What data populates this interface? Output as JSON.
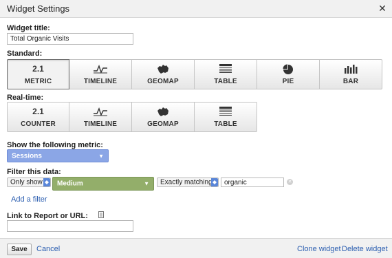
{
  "dialog": {
    "title": "Widget Settings",
    "close_glyph": "✕"
  },
  "widget_title": {
    "label": "Widget title:",
    "value": "Total Organic Visits"
  },
  "standard": {
    "label": "Standard:",
    "items": [
      {
        "icon_text": "2.1",
        "label": "METRIC",
        "icon": "metric-icon",
        "selected": true
      },
      {
        "icon_text": "",
        "label": "TIMELINE",
        "icon": "timeline-icon"
      },
      {
        "icon_text": "",
        "label": "GEOMAP",
        "icon": "geomap-icon"
      },
      {
        "icon_text": "",
        "label": "TABLE",
        "icon": "table-icon"
      },
      {
        "icon_text": "",
        "label": "PIE",
        "icon": "pie-icon"
      },
      {
        "icon_text": "",
        "label": "BAR",
        "icon": "bar-chart-icon"
      }
    ]
  },
  "realtime": {
    "label": "Real-time:",
    "items": [
      {
        "icon_text": "2.1",
        "label": "COUNTER",
        "icon": "counter-icon"
      },
      {
        "icon_text": "",
        "label": "TIMELINE",
        "icon": "timeline-icon"
      },
      {
        "icon_text": "",
        "label": "GEOMAP",
        "icon": "geomap-icon"
      },
      {
        "icon_text": "",
        "label": "TABLE",
        "icon": "table-icon"
      }
    ]
  },
  "metric": {
    "label": "Show the following metric:",
    "selected": "Sessions",
    "color": "#8ba6e6"
  },
  "filter": {
    "label": "Filter this data:",
    "mode": "Only show",
    "dimension": "Medium",
    "dimension_color": "#93ae6a",
    "match_type": "Exactly matching",
    "value": "organic",
    "add_filter_label": "Add a filter"
  },
  "link": {
    "label": "Link to Report or URL:",
    "value": ""
  },
  "footer": {
    "save_label": "Save",
    "cancel_label": "Cancel",
    "clone_label": "Clone widget",
    "delete_label": "Delete widget"
  },
  "colors": {
    "link": "#2a5db0",
    "metric_select": "#8ba6e6",
    "dimension_select": "#93ae6a"
  }
}
